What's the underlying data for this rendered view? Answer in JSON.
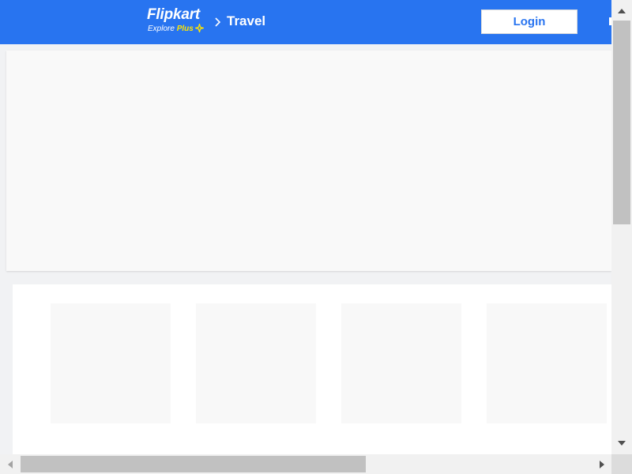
{
  "header": {
    "logo": {
      "brand": "Flipkart",
      "tagline_prefix": "Explore",
      "tagline_plus": "Plus",
      "icon": "plus-star-icon"
    },
    "breadcrumb": {
      "separator_icon": "chevron-right-icon",
      "current": "Travel"
    },
    "login_label": "Login",
    "more_icon": "menu-icon"
  },
  "colors": {
    "header_bg": "#2874f0",
    "brand_yellow": "#ffe500",
    "page_bg": "#f1f2f4",
    "placeholder": "#f9f9f9",
    "scrollbar_thumb": "#c1c1c1"
  },
  "banner": {
    "state": "loading-placeholder"
  },
  "cards": {
    "count": 4,
    "state": "loading-placeholder"
  },
  "scrollbars": {
    "vertical": {
      "icons": [
        "arrow-up-icon",
        "arrow-down-icon"
      ],
      "position": 0
    },
    "horizontal": {
      "icons": [
        "arrow-left-icon",
        "arrow-right-icon"
      ],
      "position": 0
    }
  }
}
